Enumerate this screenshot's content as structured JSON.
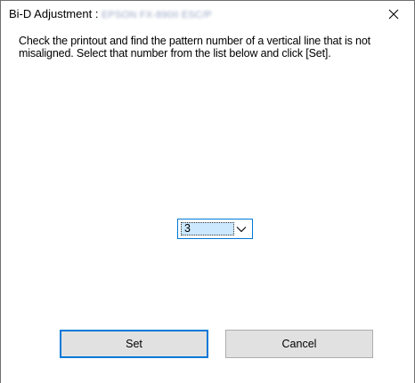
{
  "window": {
    "title_prefix": "Bi-D Adjustment : ",
    "title_printer": "EPSON FX-890II ESC/P",
    "close_glyph": "✕"
  },
  "dialog": {
    "message": "Check the printout and find the pattern number of a vertical line that is not misaligned. Select that number from the list below and click [Set].",
    "pattern_select": {
      "value": "3"
    }
  },
  "buttons": {
    "set_label": "Set",
    "cancel_label": "Cancel"
  },
  "colors": {
    "accent": "#0078d7",
    "selection": "#cce8ff",
    "button_face": "#e1e1e1"
  }
}
